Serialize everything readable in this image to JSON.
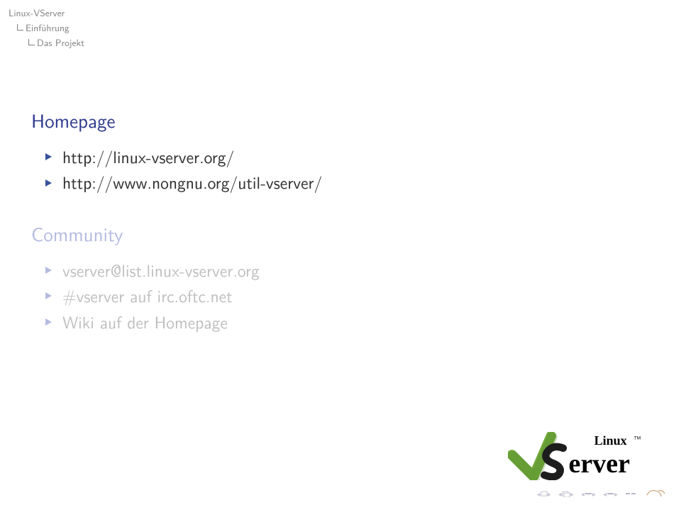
{
  "breadcrumb": {
    "top": "Linux-VServer",
    "section": "Einführung",
    "subsection": "Das Projekt"
  },
  "sections": [
    {
      "title": "Homepage",
      "dim": false,
      "items": [
        {
          "text": "http://linux-vserver.org/",
          "dim": false
        },
        {
          "text": "http://www.nongnu.org/util-vserver/",
          "dim": false
        }
      ]
    },
    {
      "title": "Community",
      "dim": true,
      "items": [
        {
          "text": "vserver@list.linux-vserver.org",
          "dim": true
        },
        {
          "text": "#vserver auf irc.oftc.net",
          "dim": true
        },
        {
          "text": "Wiki auf der Homepage",
          "dim": true
        }
      ]
    }
  ],
  "logo": {
    "text_top": "Linux",
    "text_main": "erver",
    "tm": "TM"
  }
}
